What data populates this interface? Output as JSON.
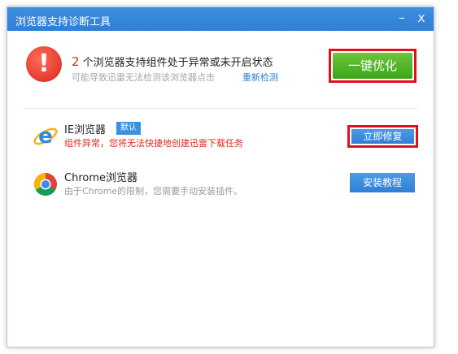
{
  "window": {
    "title": "浏览器支持诊断工具",
    "minimize_glyph": "–",
    "close_glyph": "x"
  },
  "summary": {
    "count": "2",
    "headline_text": " 个浏览器支持组件处于异常或未开启状态",
    "subline": "可能导致迅雷无法检测该浏览器点击",
    "recheck_link": "重新检测",
    "optimize_button": "一键优化",
    "icon": "warning-exclamation-icon"
  },
  "browsers": [
    {
      "name": "IE浏览器",
      "badge": "默认",
      "status_text": "组件异常，您将无法快捷地创建迅雷下载任务",
      "action_label": "立即修复",
      "icon": "ie-icon"
    },
    {
      "name": "Chrome浏览器",
      "status_text": "由于Chrome的限制，您需要手动安装插件。",
      "action_label": "安装教程",
      "icon": "chrome-icon"
    }
  ],
  "colors": {
    "title_bar": "#2f7fd6",
    "accent_blue": "#2a7fd6",
    "error_red": "#e02a1e",
    "highlight_border": "#e0101a",
    "optimize_green": "#3aa519"
  }
}
